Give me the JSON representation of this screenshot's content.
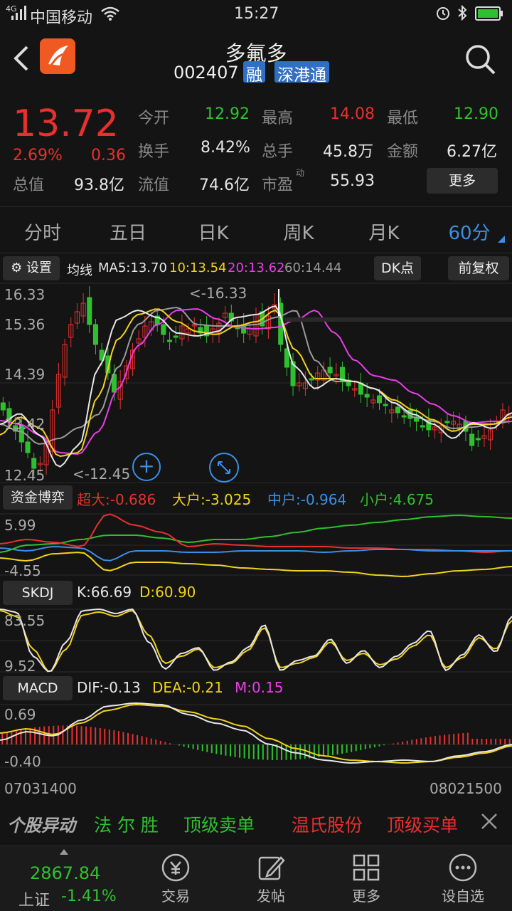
{
  "status": {
    "network": "4G",
    "carrier": "中国移动",
    "time": "15:27"
  },
  "stock": {
    "name": "多氟多",
    "code": "002407",
    "badges": [
      "融",
      "深港通"
    ]
  },
  "quote": {
    "price": "13.72",
    "change_pct": "2.69%",
    "change": "0.36",
    "open_label": "今开",
    "open": "12.92",
    "high_label": "最高",
    "high": "14.08",
    "low_label": "最低",
    "low": "12.90",
    "turnover_label": "换手",
    "turnover": "8.42%",
    "volume_label": "总手",
    "volume": "45.8万",
    "amount_label": "金额",
    "amount": "6.27亿",
    "mcap_label": "总值",
    "mcap": "93.8亿",
    "float_label": "流值",
    "float": "74.6亿",
    "pe_label": "市盈",
    "pe_sup": "动",
    "pe": "55.93",
    "more_label": "更多"
  },
  "tabs": [
    "分时",
    "五日",
    "日K",
    "周K",
    "月K",
    "60分"
  ],
  "kline": {
    "settings_label": "设置",
    "ma_title": "均线",
    "ma5": "MA5:13.70",
    "ma10": "10:13.54",
    "ma20": "20:13.62",
    "ma60": "60:14.44",
    "dk_label": "DK点",
    "adjust_label": "前复权",
    "y_labels": [
      "16.33",
      "15.36",
      "14.39",
      "13.42",
      "12.45"
    ],
    "max_marker": "<-16.33",
    "min_marker": "<-12.45"
  },
  "capital": {
    "label": "资金博弈",
    "super": "超大:-0.686",
    "large": "大户:-3.025",
    "mid": "中户:-0.964",
    "small": "小户:4.675",
    "y_top": "5.99",
    "y_bottom": "-4.55"
  },
  "skdj": {
    "label": "SKDJ",
    "k": "K:66.69",
    "d": "D:60.90",
    "y_top": "83.55",
    "y_bottom": "9.52"
  },
  "macd": {
    "label": "MACD",
    "dif": "DIF:-0.13",
    "dea": "DEA:-0.21",
    "m": "M:0.15",
    "y_top": "0.69",
    "y_bottom": "-0.40"
  },
  "dates": {
    "start": "07031400",
    "end": "08021500"
  },
  "ticker": {
    "title": "个股异动",
    "items": [
      "法 尔 胜",
      "顶级卖单",
      "温氏股份",
      "顶级买单"
    ]
  },
  "index": {
    "value": "2867.84",
    "name": "上证",
    "change": "-1.41%"
  },
  "nav": [
    "交易",
    "发帖",
    "更多",
    "设自选"
  ],
  "colors": {
    "up": "#e8302e",
    "down": "#2fc02f",
    "accent": "#3a8fe6",
    "logo": "#f05a22"
  }
}
